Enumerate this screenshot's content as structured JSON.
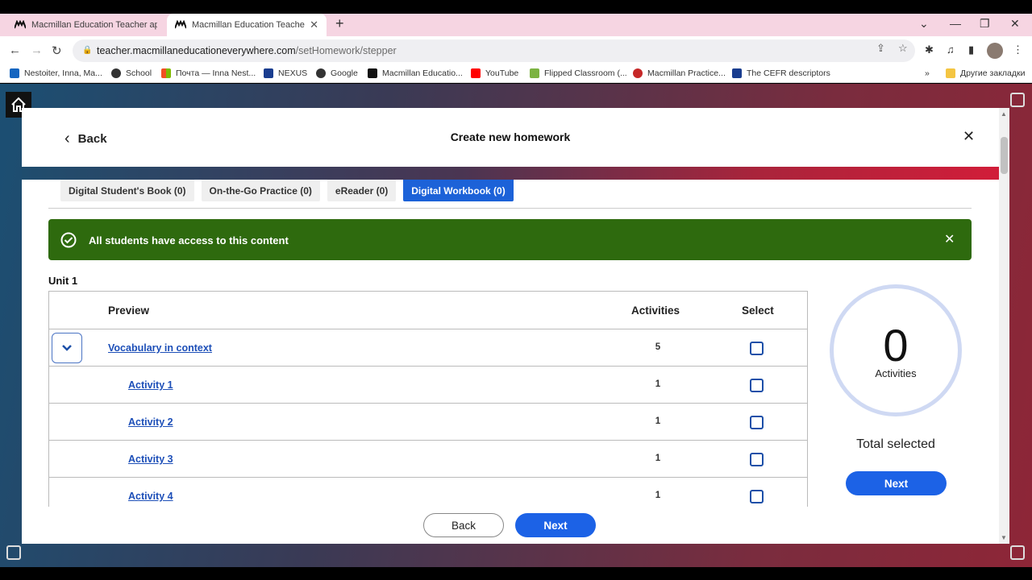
{
  "browser": {
    "tabs": [
      {
        "title": "Macmillan Education Teacher ap",
        "active": false
      },
      {
        "title": "Macmillan Education Teacher - S",
        "active": true
      }
    ],
    "new_tab": "+",
    "url_host": "teacher.macmillaneducationeverywhere.com",
    "url_path": "/setHomework/stepper",
    "bookmarks": [
      {
        "label": "Nestoiter, Inna, Ma...",
        "color": "#1565c0"
      },
      {
        "label": "School",
        "color": "#333333"
      },
      {
        "label": "Почта — Inna Nest...",
        "color": "#f25022"
      },
      {
        "label": "NEXUS",
        "color": "#1a3d8f"
      },
      {
        "label": "Google",
        "color": "#333333"
      },
      {
        "label": "Macmillan Educatio...",
        "color": "#111111"
      },
      {
        "label": "YouTube",
        "color": "#ff0000"
      },
      {
        "label": "Flipped Classroom (...",
        "color": "#7cb342"
      },
      {
        "label": "Macmillan Practice...",
        "color": "#c62828"
      },
      {
        "label": "The CEFR descriptors",
        "color": "#1a3d8f"
      }
    ],
    "more_bookmarks": "»",
    "other_bookmarks": "Другие закладки"
  },
  "modal": {
    "back_label": "Back",
    "title": "Create new homework",
    "tabs": [
      {
        "label": "Digital Student's Book (0)",
        "active": false
      },
      {
        "label": "On-the-Go Practice (0)",
        "active": false
      },
      {
        "label": "eReader (0)",
        "active": false
      },
      {
        "label": "Digital Workbook (0)",
        "active": true
      }
    ],
    "banner_text": "All students have access to this content",
    "unit_title": "Unit 1",
    "table": {
      "headers": {
        "preview": "Preview",
        "activities": "Activities",
        "select": "Select"
      },
      "rows": [
        {
          "label": "Vocabulary in context",
          "count": "5",
          "level": 0,
          "expanded": true
        },
        {
          "label": "Activity 1",
          "count": "1",
          "level": 1
        },
        {
          "label": "Activity 2",
          "count": "1",
          "level": 1
        },
        {
          "label": "Activity 3",
          "count": "1",
          "level": 1
        },
        {
          "label": "Activity 4",
          "count": "1",
          "level": 1
        }
      ]
    },
    "summary": {
      "count": "0",
      "count_label": "Activities",
      "total_label": "Total selected",
      "next_label": "Next"
    },
    "footer": {
      "back_label": "Back",
      "next_label": "Next"
    }
  },
  "colors": {
    "primary": "#1c62e6",
    "banner": "#2e6a0e",
    "link": "#1d4fb8"
  }
}
